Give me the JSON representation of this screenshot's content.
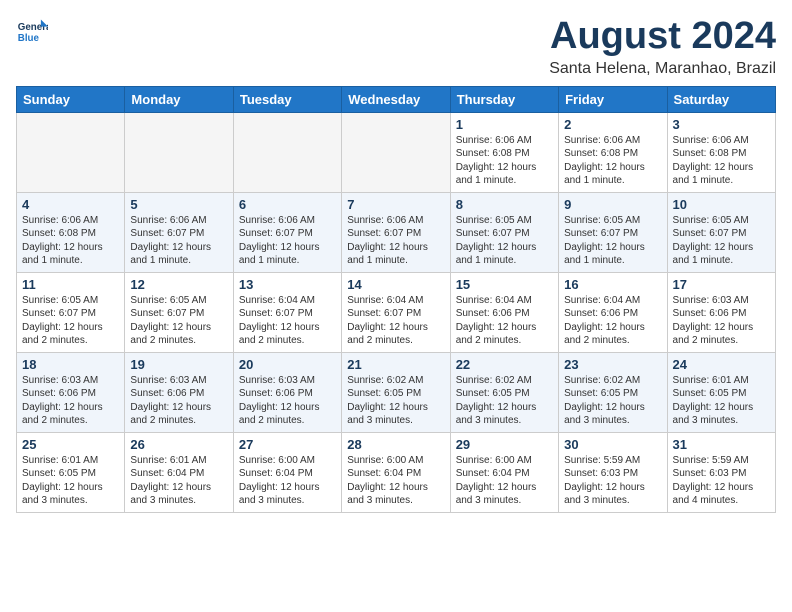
{
  "header": {
    "logo_line1": "General",
    "logo_line2": "Blue",
    "title": "August 2024",
    "subtitle": "Santa Helena, Maranhao, Brazil"
  },
  "weekdays": [
    "Sunday",
    "Monday",
    "Tuesday",
    "Wednesday",
    "Thursday",
    "Friday",
    "Saturday"
  ],
  "weeks": [
    [
      {
        "day": "",
        "empty": true
      },
      {
        "day": "",
        "empty": true
      },
      {
        "day": "",
        "empty": true
      },
      {
        "day": "",
        "empty": true
      },
      {
        "day": "1",
        "sunrise": "6:06 AM",
        "sunset": "6:08 PM",
        "daylight": "12 hours and 1 minute."
      },
      {
        "day": "2",
        "sunrise": "6:06 AM",
        "sunset": "6:08 PM",
        "daylight": "12 hours and 1 minute."
      },
      {
        "day": "3",
        "sunrise": "6:06 AM",
        "sunset": "6:08 PM",
        "daylight": "12 hours and 1 minute."
      }
    ],
    [
      {
        "day": "4",
        "sunrise": "6:06 AM",
        "sunset": "6:08 PM",
        "daylight": "12 hours and 1 minute."
      },
      {
        "day": "5",
        "sunrise": "6:06 AM",
        "sunset": "6:07 PM",
        "daylight": "12 hours and 1 minute."
      },
      {
        "day": "6",
        "sunrise": "6:06 AM",
        "sunset": "6:07 PM",
        "daylight": "12 hours and 1 minute."
      },
      {
        "day": "7",
        "sunrise": "6:06 AM",
        "sunset": "6:07 PM",
        "daylight": "12 hours and 1 minute."
      },
      {
        "day": "8",
        "sunrise": "6:05 AM",
        "sunset": "6:07 PM",
        "daylight": "12 hours and 1 minute."
      },
      {
        "day": "9",
        "sunrise": "6:05 AM",
        "sunset": "6:07 PM",
        "daylight": "12 hours and 1 minute."
      },
      {
        "day": "10",
        "sunrise": "6:05 AM",
        "sunset": "6:07 PM",
        "daylight": "12 hours and 1 minute."
      }
    ],
    [
      {
        "day": "11",
        "sunrise": "6:05 AM",
        "sunset": "6:07 PM",
        "daylight": "12 hours and 2 minutes."
      },
      {
        "day": "12",
        "sunrise": "6:05 AM",
        "sunset": "6:07 PM",
        "daylight": "12 hours and 2 minutes."
      },
      {
        "day": "13",
        "sunrise": "6:04 AM",
        "sunset": "6:07 PM",
        "daylight": "12 hours and 2 minutes."
      },
      {
        "day": "14",
        "sunrise": "6:04 AM",
        "sunset": "6:07 PM",
        "daylight": "12 hours and 2 minutes."
      },
      {
        "day": "15",
        "sunrise": "6:04 AM",
        "sunset": "6:06 PM",
        "daylight": "12 hours and 2 minutes."
      },
      {
        "day": "16",
        "sunrise": "6:04 AM",
        "sunset": "6:06 PM",
        "daylight": "12 hours and 2 minutes."
      },
      {
        "day": "17",
        "sunrise": "6:03 AM",
        "sunset": "6:06 PM",
        "daylight": "12 hours and 2 minutes."
      }
    ],
    [
      {
        "day": "18",
        "sunrise": "6:03 AM",
        "sunset": "6:06 PM",
        "daylight": "12 hours and 2 minutes."
      },
      {
        "day": "19",
        "sunrise": "6:03 AM",
        "sunset": "6:06 PM",
        "daylight": "12 hours and 2 minutes."
      },
      {
        "day": "20",
        "sunrise": "6:03 AM",
        "sunset": "6:06 PM",
        "daylight": "12 hours and 2 minutes."
      },
      {
        "day": "21",
        "sunrise": "6:02 AM",
        "sunset": "6:05 PM",
        "daylight": "12 hours and 3 minutes."
      },
      {
        "day": "22",
        "sunrise": "6:02 AM",
        "sunset": "6:05 PM",
        "daylight": "12 hours and 3 minutes."
      },
      {
        "day": "23",
        "sunrise": "6:02 AM",
        "sunset": "6:05 PM",
        "daylight": "12 hours and 3 minutes."
      },
      {
        "day": "24",
        "sunrise": "6:01 AM",
        "sunset": "6:05 PM",
        "daylight": "12 hours and 3 minutes."
      }
    ],
    [
      {
        "day": "25",
        "sunrise": "6:01 AM",
        "sunset": "6:05 PM",
        "daylight": "12 hours and 3 minutes."
      },
      {
        "day": "26",
        "sunrise": "6:01 AM",
        "sunset": "6:04 PM",
        "daylight": "12 hours and 3 minutes."
      },
      {
        "day": "27",
        "sunrise": "6:00 AM",
        "sunset": "6:04 PM",
        "daylight": "12 hours and 3 minutes."
      },
      {
        "day": "28",
        "sunrise": "6:00 AM",
        "sunset": "6:04 PM",
        "daylight": "12 hours and 3 minutes."
      },
      {
        "day": "29",
        "sunrise": "6:00 AM",
        "sunset": "6:04 PM",
        "daylight": "12 hours and 3 minutes."
      },
      {
        "day": "30",
        "sunrise": "5:59 AM",
        "sunset": "6:03 PM",
        "daylight": "12 hours and 3 minutes."
      },
      {
        "day": "31",
        "sunrise": "5:59 AM",
        "sunset": "6:03 PM",
        "daylight": "12 hours and 4 minutes."
      }
    ]
  ],
  "labels": {
    "sunrise_prefix": "Sunrise: ",
    "sunset_prefix": "Sunset: ",
    "daylight_prefix": "Daylight: "
  }
}
